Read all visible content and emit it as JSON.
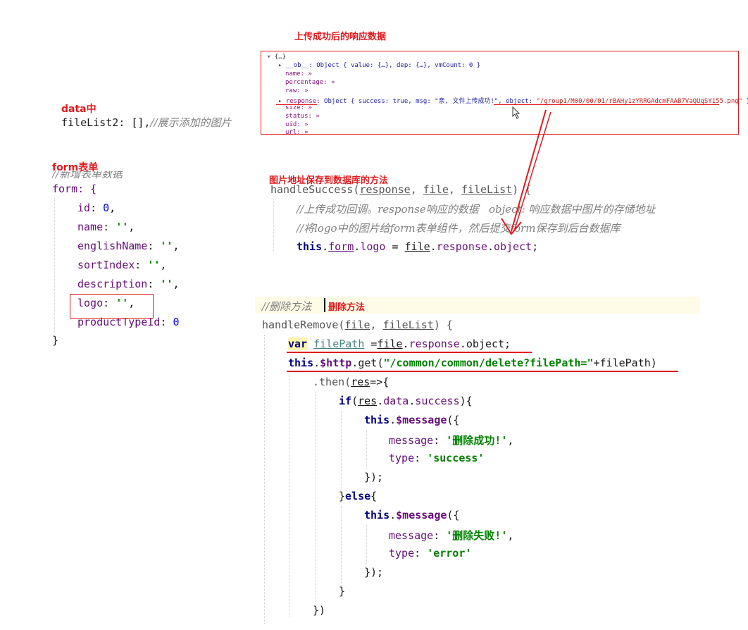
{
  "labels": {
    "response_title": "上传成功后的响应数据",
    "data_section": "data中",
    "form_section": "form表单",
    "save_method": "图片地址保存到数据库的方法",
    "delete_method": "删除方法"
  },
  "console": {
    "root": "{…}",
    "ob": "__ob__: Object { value: {…}, dep: {…}, vmCount: 0 }",
    "name": "name: »",
    "percentage": "percentage: »",
    "raw": "raw: »",
    "response_key": "response:",
    "response_val_pre": "Object { success: true, msg: \"亲, 文件上传成功!\", ",
    "response_obj_key": "object:",
    "response_obj_val": "\"/group1/M00/00/01/rBAHy1zYRRGAdcmFAAB7VaQUqSY155.png\"",
    "response_close": " }",
    "size": "size: »",
    "status": "status: »",
    "uid": "uid: »",
    "url": "url: »"
  },
  "data_code": {
    "line": "fileList2: [],",
    "comment": "//展示添加的图片"
  },
  "form_code": {
    "hidden_comment": "//新增表单数据",
    "open": "form: {",
    "fields": [
      {
        "key": "id",
        "value": "0",
        "kind": "num",
        "sep": ","
      },
      {
        "key": "name",
        "value": "''",
        "kind": "str",
        "sep": ","
      },
      {
        "key": "englishName",
        "value": "''",
        "kind": "str",
        "sep": ","
      },
      {
        "key": "sortIndex",
        "value": "''",
        "kind": "str",
        "sep": ","
      },
      {
        "key": "description",
        "value": "''",
        "kind": "str",
        "sep": ","
      },
      {
        "key": "logo",
        "value": "''",
        "kind": "str",
        "sep": ","
      },
      {
        "key": "productTypeId",
        "value": "0",
        "kind": "num",
        "sep": ""
      }
    ],
    "close": "}"
  },
  "success_code": {
    "fn": "handleSuccess",
    "params": [
      "response",
      "file",
      "fileList"
    ],
    "sig_tail": ") {",
    "comment1": "//上传成功回调。response响应的数据   object: 响应数据中图片的存储地址",
    "comment2": "//将logo中的图片给form表单组件，然后提交form保存到后台数据库",
    "assign": {
      "this": "this",
      "form": "form",
      "logo": "logo",
      "eq": " = ",
      "file": "file",
      "resp": "response",
      "obj": "object",
      "end": ";"
    }
  },
  "remove_code": {
    "comment": "//删除方法",
    "fn": "handleRemove",
    "params": [
      "file",
      "fileList"
    ],
    "sig_tail": ") {",
    "var_kw": "var",
    "var_name": "filePath",
    "var_eq": " =",
    "var_file": "file",
    "var_resp": "response",
    "var_obj": "object;",
    "get_this": "this",
    "get_http": "$http",
    "get_fn": "get",
    "get_url": "\"/common/common/delete?filePath=\"",
    "get_tail": "+filePath)",
    "then": ".then(",
    "then_res": "res",
    "then_arrow": "=>{",
    "if_kw": "if",
    "if_res": "res",
    "if_data": "data",
    "if_success": "success",
    "if_tail": "){",
    "msg_this": "this",
    "msg_fn": "$message",
    "msg_open": "({",
    "message_key": "message",
    "ok_text": "'删除成功!'",
    "type_key": "type",
    "ok_type": "'success'",
    "fail_text": "'删除失败!'",
    "fail_type": "'error'",
    "msg_close": "});",
    "else_open": "}",
    "else_kw": "else",
    "else_brace": "{",
    "brace_close": "}",
    "then_close": "})"
  }
}
